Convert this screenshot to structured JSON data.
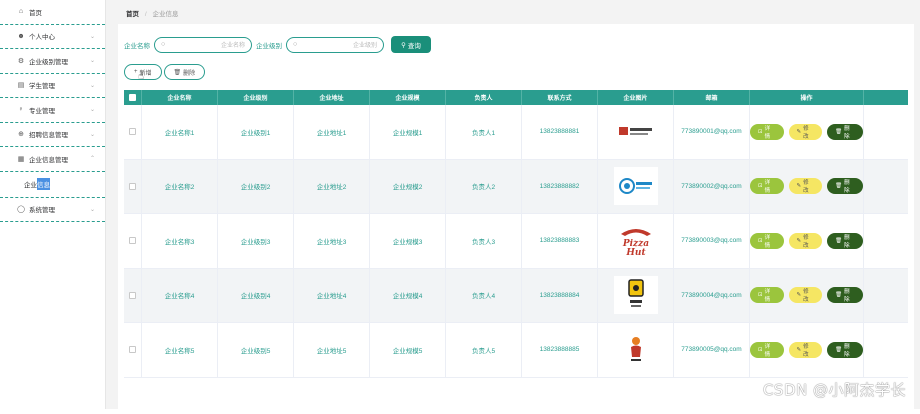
{
  "sidebar": {
    "items": [
      {
        "label": "首页",
        "icon": "home-icon",
        "glyph": "⌂"
      },
      {
        "label": "个人中心",
        "icon": "user-icon",
        "glyph": "👤"
      },
      {
        "label": "企业级别管理",
        "icon": "cog-icon",
        "glyph": "⚙"
      },
      {
        "label": "学生管理",
        "icon": "card-icon",
        "glyph": "▤"
      },
      {
        "label": "专业管理",
        "icon": "mic-icon",
        "glyph": "♀"
      },
      {
        "label": "招聘信息管理",
        "icon": "globe-icon",
        "glyph": "⊕"
      },
      {
        "label": "企业信息管理",
        "icon": "building-icon",
        "glyph": "▦"
      },
      {
        "label": "系统管理",
        "icon": "circle-icon",
        "glyph": "◯"
      }
    ],
    "submenu_prefix": "企业",
    "submenu_highlight": "信息"
  },
  "breadcrumb": {
    "home": "首页",
    "separator": "/",
    "current": "企业信息"
  },
  "search": {
    "name_label": "企业名称",
    "name_placeholder": "企业名称",
    "level_label": "企业级别",
    "level_placeholder": "企业级别",
    "query_button": "查询"
  },
  "actions": {
    "add_label": "新增",
    "delete_label": "删除"
  },
  "table": {
    "headers": [
      "企业名称",
      "企业级别",
      "企业地址",
      "企业规模",
      "负责人",
      "联系方式",
      "企业图片",
      "邮箱",
      "操作"
    ],
    "rows": [
      {
        "name": "企业名称1",
        "level": "企业级别1",
        "address": "企业地址1",
        "scale": "企业规模1",
        "owner": "负责人1",
        "phone": "13823888881",
        "image": "logo-chinese-company",
        "email": "773890001@qq.com"
      },
      {
        "name": "企业名称2",
        "level": "企业级别2",
        "address": "企业地址2",
        "scale": "企业规模2",
        "owner": "负责人2",
        "phone": "13823888882",
        "image": "logo-china-mobile",
        "email": "773890002@qq.com"
      },
      {
        "name": "企业名称3",
        "level": "企业级别3",
        "address": "企业地址3",
        "scale": "企业规模3",
        "owner": "负责人3",
        "phone": "13823888883",
        "image": "logo-pizza-hut",
        "email": "773890003@qq.com"
      },
      {
        "name": "企业名称4",
        "level": "企业级别4",
        "address": "企业地址4",
        "scale": "企业规模4",
        "owner": "负责人4",
        "phone": "13823888884",
        "image": "logo-yellow-emblem",
        "email": "773890004@qq.com"
      },
      {
        "name": "企业名称5",
        "level": "企业级别5",
        "address": "企业地址5",
        "scale": "企业规模5",
        "owner": "负责人5",
        "phone": "13823888885",
        "image": "logo-figure",
        "email": "773890005@qq.com"
      }
    ],
    "op_detail": "详情",
    "op_edit": "修改",
    "op_delete": "删除"
  },
  "mobile_logo_text": "中国移动",
  "pizza_logo_text": "Pizza Hut",
  "watermark": "CSDN @小阿杰学长",
  "colors": {
    "accent": "#2a9d8f",
    "detail": "#9bc53d",
    "edit": "#f5e663",
    "delete": "#2e5e1f"
  }
}
